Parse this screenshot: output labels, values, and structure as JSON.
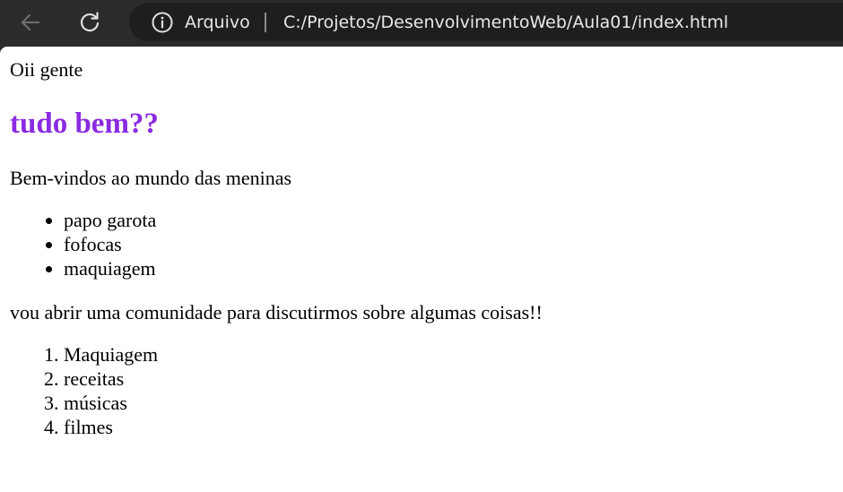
{
  "browser": {
    "site_label": "Arquivo",
    "url": "C:/Projetos/DesenvolvimentoWeb/Aula01/index.html",
    "icons": {
      "back": "arrow-left-icon",
      "reload": "reload-icon",
      "info": "info-icon"
    }
  },
  "page": {
    "intro": "Oii gente",
    "heading": "tudo bem??",
    "heading_color": "#8a2be2",
    "welcome": "Bem-vindos ao mundo das meninas",
    "bullets": [
      "papo garota",
      "fofocas",
      "maquiagem"
    ],
    "community": "vou abrir uma comunidade para discutirmos sobre algumas coisas!!",
    "numbered": [
      "Maquiagem",
      "receitas",
      "músicas",
      "filmes"
    ]
  }
}
